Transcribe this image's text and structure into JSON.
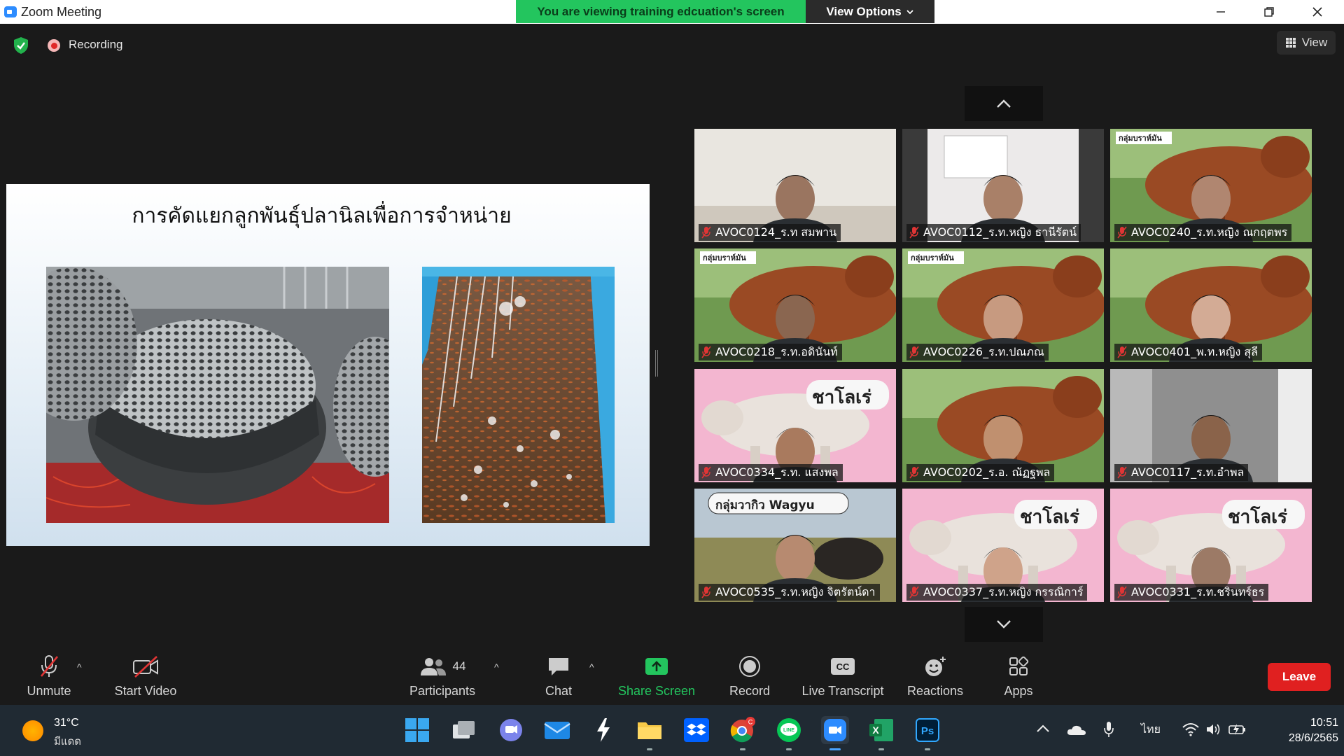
{
  "window": {
    "title": "Zoom Meeting",
    "share_banner": "You are viewing training edcuation's screen",
    "view_options_label": "View Options"
  },
  "status": {
    "recording_label": "Recording",
    "view_label": "View"
  },
  "slide": {
    "title": "การคัดแยกลูกพันธุ์ปลานิลเพื่อการจำหน่าย"
  },
  "gallery": {
    "participants": [
      {
        "name": "AVOC0124_ร.ท สมพาน",
        "muted": true
      },
      {
        "name": "AVOC0112_ร.ท.หญิง ธานีรัตน์",
        "muted": true
      },
      {
        "name": "AVOC0240_ร.ท.หญิง ณกฤตพร",
        "muted": true
      },
      {
        "name": "AVOC0218_ร.ท.อดินันท์",
        "muted": true
      },
      {
        "name": "AVOC0226_ร.ท.ปณภณ",
        "muted": true
      },
      {
        "name": "AVOC0401_พ.ท.หญิง สุลี",
        "muted": true
      },
      {
        "name": "AVOC0334_ร.ท. แสงพล",
        "muted": true
      },
      {
        "name": "AVOC0202_ร.อ. ณัฏฐพล",
        "muted": true
      },
      {
        "name": "AVOC0117_ร.ท.อำพล",
        "muted": true
      },
      {
        "name": "AVOC0535_ร.ท.หญิง จิตรัตน์ดา",
        "muted": true
      },
      {
        "name": "AVOC0337_ร.ท.หญิง กรรณิการ์",
        "muted": true
      },
      {
        "name": "AVOC0331_ร.ท.ชรินทร์ธร",
        "muted": true
      }
    ],
    "bg_labels": {
      "herd": "กลุ่มบราห์มัน",
      "charolais": "ชาโลเร่",
      "wagyu": "กลุ่มวากิว Wagyu"
    }
  },
  "toolbar": {
    "unmute": "Unmute",
    "start_video": "Start Video",
    "participants": "Participants",
    "participants_count": "44",
    "chat": "Chat",
    "share_screen": "Share Screen",
    "record": "Record",
    "live_transcript": "Live Transcript",
    "cc_badge": "CC",
    "reactions": "Reactions",
    "apps": "Apps",
    "leave": "Leave"
  },
  "taskbar": {
    "weather_temp": "31°C",
    "weather_condition": "มีแดด",
    "language": "ไทย",
    "time": "10:51",
    "date": "28/6/2565",
    "line_label": "LINE",
    "ps_label": "Ps",
    "excel_label": "X",
    "chrome_badge": "C"
  },
  "colors": {
    "banner_green": "#23c55e",
    "leave_red": "#e02020",
    "share_green": "#23c55e",
    "zoom_blue": "#2d8cff"
  }
}
